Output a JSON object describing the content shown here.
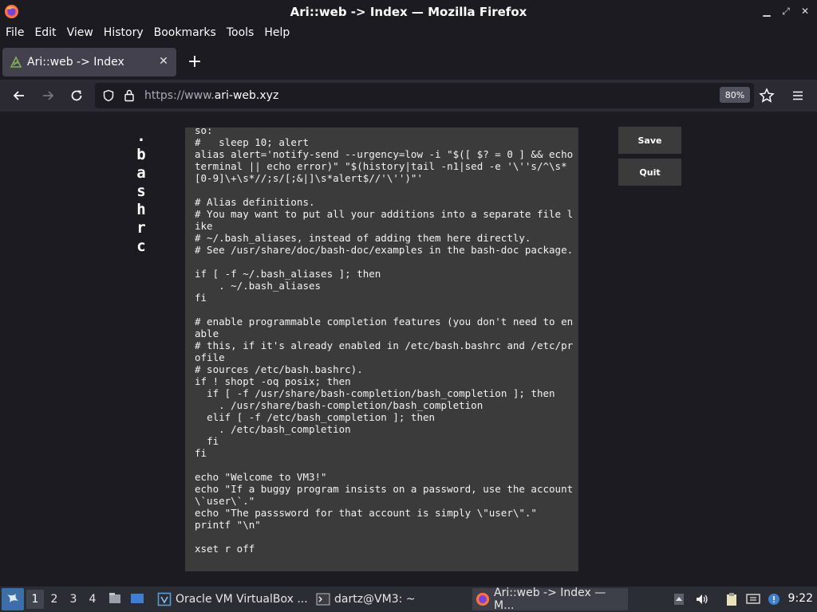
{
  "window": {
    "title": "Ari::web -> Index — Mozilla Firefox",
    "controls": [
      "minimize",
      "maximize",
      "close"
    ]
  },
  "menubar": {
    "items": [
      "File",
      "Edit",
      "View",
      "History",
      "Bookmarks",
      "Tools",
      "Help"
    ]
  },
  "tab": {
    "label": "Ari::web -> Index",
    "close_glyph": "✕",
    "new_tab_glyph": "+"
  },
  "navbar": {
    "url_prefix": "https://www.",
    "url_domain": "ari-web.xyz",
    "zoom": "80%"
  },
  "page": {
    "vertical_title": [
      ".",
      "b",
      "a",
      "s",
      "h",
      "r",
      "c"
    ],
    "editor_text": "so:\n#   sleep 10; alert\nalias alert='notify-send --urgency=low -i \"$([ $? = 0 ] && echo terminal || echo error)\" \"$(history|tail -n1|sed -e '\\''s/^\\s*[0-9]\\+\\s*//;s/[;&|]\\s*alert$//'\\'')\"'\n\n# Alias definitions.\n# You may want to put all your additions into a separate file like\n# ~/.bash_aliases, instead of adding them here directly.\n# See /usr/share/doc/bash-doc/examples in the bash-doc package.\n\nif [ -f ~/.bash_aliases ]; then\n    . ~/.bash_aliases\nfi\n\n# enable programmable completion features (you don't need to enable\n# this, if it's already enabled in /etc/bash.bashrc and /etc/profile\n# sources /etc/bash.bashrc).\nif ! shopt -oq posix; then\n  if [ -f /usr/share/bash-completion/bash_completion ]; then\n    . /usr/share/bash-completion/bash_completion\n  elif [ -f /etc/bash_completion ]; then\n    . /etc/bash_completion\n  fi\nfi\n\necho \"Welcome to VM3!\"\necho \"If a buggy program insists on a password, use the account \\`user\\`.\"\necho \"The passsword for that account is simply \\\"user\\\".\"\nprintf \"\\n\"\n\nxset r off",
    "save_label": "Save",
    "quit_label": "Quit"
  },
  "taskbar": {
    "workspaces": [
      "1",
      "2",
      "3",
      "4"
    ],
    "active_workspace": "1",
    "tasks": [
      {
        "label": "Oracle VM VirtualBox ...",
        "icon": "virtualbox-icon"
      },
      {
        "label": "dartz@VM3: ~",
        "icon": "terminal-icon"
      },
      {
        "label": "Ari::web -> Index — M...",
        "icon": "firefox-icon"
      }
    ],
    "clock": "9:22"
  },
  "colors": {
    "chrome_bg": "#1c1b22",
    "navbar_bg": "#2b2a33",
    "tab_bg": "#42414d",
    "editor_bg": "#3b3b3b",
    "taskbar_bg": "#2a2d34",
    "start_bg": "#3c6ea8"
  }
}
